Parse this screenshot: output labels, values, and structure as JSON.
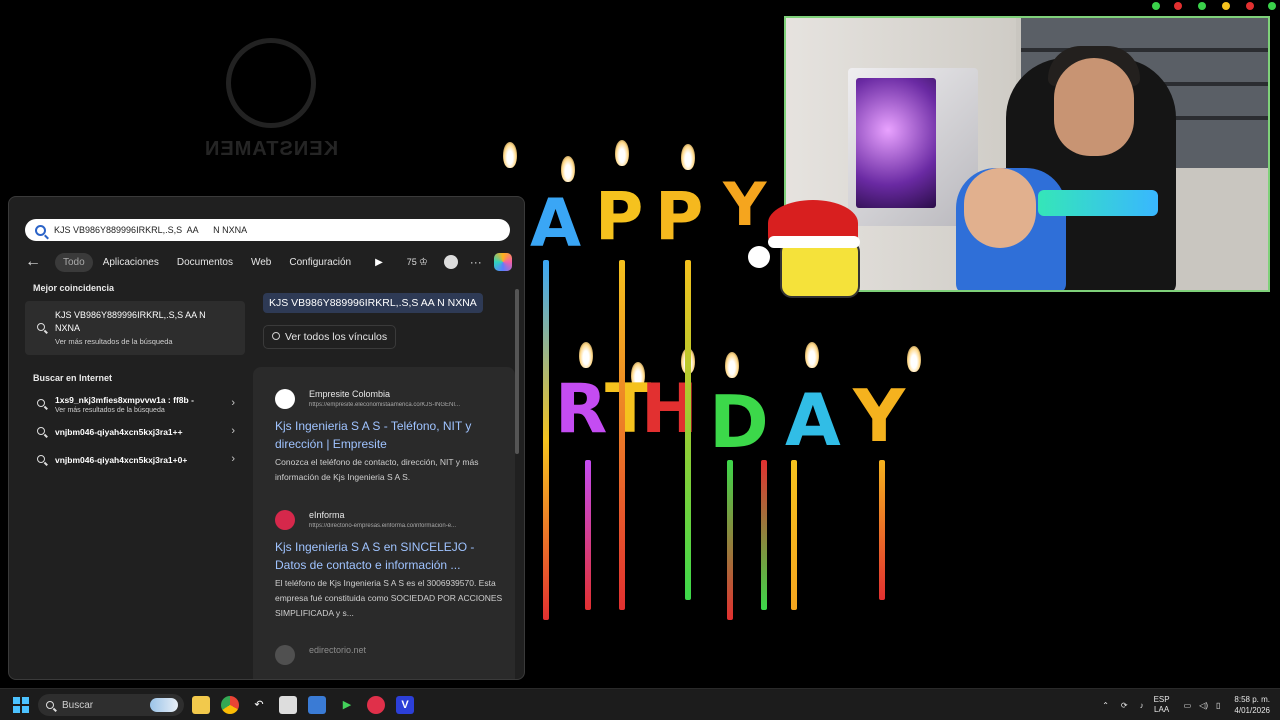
{
  "background": {
    "logo_text": "KENSTAMEN",
    "birthday_letters": [
      "A",
      "P",
      "P",
      "Y",
      "R",
      "T",
      "H",
      "D",
      "A",
      "Y"
    ]
  },
  "search": {
    "query": "KJS VB986Y889996IRKRL,.S,S  AA      N NXNA",
    "tabs": [
      "Todo",
      "Aplicaciones",
      "Documentos",
      "Web",
      "Configuración"
    ],
    "active_tab": "Todo",
    "count": "75",
    "best_match_title": "Mejor coincidencia",
    "best_match": {
      "title": "KJS VB986Y889996IRKRL,.S,S AA N NXNA",
      "subtitle": "Ver más resultados de la búsqueda"
    },
    "internet_title": "Buscar en Internet",
    "internet_items": [
      {
        "title": "1xs9_nkj3mfies8xmpvvw1a : ff8b -",
        "subtitle": "Ver más resultados de la búsqueda"
      },
      {
        "title": "vnjbm046-qiyah4xcn5kxj3ra1++",
        "subtitle": ""
      },
      {
        "title": "vnjbm046-qiyah4xcn5kxj3ra1+0+",
        "subtitle": ""
      }
    ],
    "query_chip": "KJS VB986Y889996IRKRL,.S,S AA N NXNA",
    "all_links": "Ver todos los vínculos",
    "results": [
      {
        "site": "Empresite Colombia",
        "url": "https://empresite.eleconomistaamerica.co/KJS-INGENI...",
        "title": "Kjs Ingenieria S A S - Teléfono, NIT y dirección | Empresite",
        "snippet": "Conozca el teléfono de contacto, dirección, NIT y más información de Kjs Ingenieria S A S."
      },
      {
        "site": "eInforma",
        "url": "https://directorio-empresas.einforma.co/informacion-e...",
        "title": "Kjs Ingenieria S A S en SINCELEJO - Datos de contacto e información ...",
        "snippet": "El teléfono de Kjs Ingenieria S A S es el 3006939570. Esta empresa fué constituida como SOCIEDAD POR ACCIONES SIMPLIFICADA y s..."
      },
      {
        "site": "edirectorio.net",
        "url": "",
        "title": "",
        "snippet": ""
      }
    ]
  },
  "taskbar": {
    "search_label": "Buscar",
    "lang_top": "ESP",
    "lang_bottom": "LAA",
    "time": "8:58 p. m.",
    "date": "4/01/2026"
  }
}
